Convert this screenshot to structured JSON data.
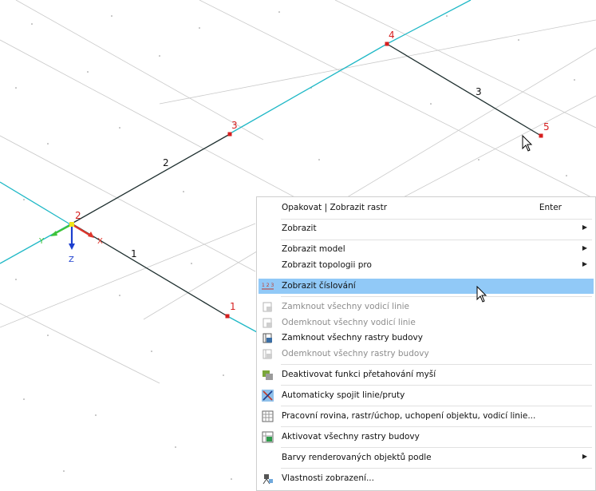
{
  "viewport": {
    "node_labels": [
      "1",
      "2",
      "3",
      "4",
      "5"
    ],
    "member_labels": [
      "1",
      "2",
      "3"
    ],
    "axis_labels": {
      "x": "X",
      "y": "Y",
      "z": "Z"
    },
    "colors": {
      "line": "#1fb8c6",
      "member": "#1e2f2f",
      "node": "#d61f1f",
      "grid": "#c9c9c9"
    }
  },
  "menu": {
    "items": [
      {
        "id": "repeat",
        "label": "Opakovat | Zobrazit rastr",
        "shortcut": "Enter"
      },
      {
        "id": "show",
        "label": "Zobrazit",
        "submenu": true
      },
      {
        "id": "show-model",
        "label": "Zobrazit model",
        "submenu": true
      },
      {
        "id": "show-topology",
        "label": "Zobrazit topologii pro",
        "submenu": true
      },
      {
        "id": "show-numbering",
        "label": "Zobrazit číslování",
        "highlighted": true,
        "icon": "numbering-icon"
      },
      {
        "id": "lock-guides",
        "label": "Zamknout všechny vodicí linie",
        "disabled": true,
        "icon": "lock-guide-icon"
      },
      {
        "id": "unlock-guides",
        "label": "Odemknout všechny vodicí linie",
        "disabled": true,
        "icon": "unlock-guide-icon"
      },
      {
        "id": "lock-grids",
        "label": "Zamknout všechny rastry budovy",
        "icon": "lock-grid-icon"
      },
      {
        "id": "unlock-grids",
        "label": "Odemknout všechny rastry budovy",
        "disabled": true,
        "icon": "unlock-grid-icon"
      },
      {
        "id": "disable-drag",
        "label": "Deaktivovat funkci přetahování myší",
        "icon": "drag-icon"
      },
      {
        "id": "auto-connect",
        "label": "Automaticky spojit linie/pruty",
        "icon": "connect-icon"
      },
      {
        "id": "workplane",
        "label": "Pracovní rovina, rastr/úchop, uchopení objektu, vodicí linie...",
        "icon": "grid-settings-icon"
      },
      {
        "id": "activate-grids",
        "label": "Aktivovat všechny rastry budovy",
        "icon": "activate-grid-icon"
      },
      {
        "id": "render-colors",
        "label": "Barvy renderovaných objektů podle",
        "submenu": true
      },
      {
        "id": "display-props",
        "label": "Vlastnosti zobrazení...",
        "icon": "display-props-icon"
      }
    ]
  }
}
